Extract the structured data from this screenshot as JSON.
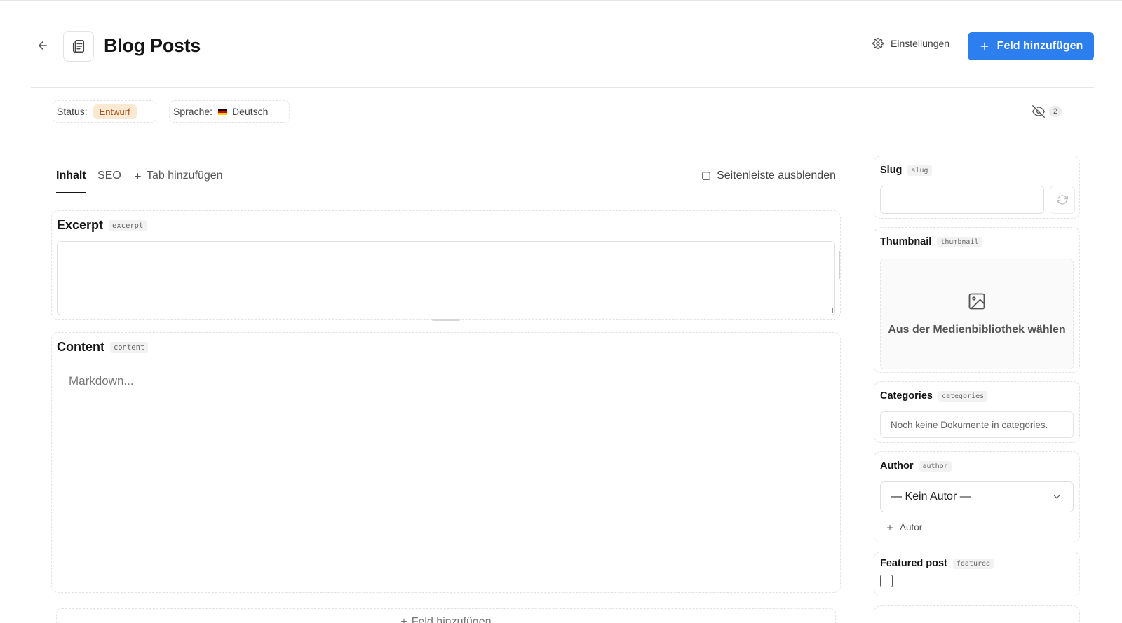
{
  "header": {
    "title": "Blog Posts",
    "settings_label": "Einstellungen",
    "add_field_label": "Feld hinzufügen"
  },
  "meta": {
    "status_label": "Status:",
    "status_value": "Entwurf",
    "language_label": "Sprache:",
    "language_value": "Deutsch",
    "hidden_fields_count": "2"
  },
  "tabs": {
    "items": [
      {
        "label": "Inhalt"
      },
      {
        "label": "SEO"
      }
    ],
    "add_tab_label": "Tab hinzufügen",
    "hide_sidebar_label": "Seitenleiste ausblenden"
  },
  "fields": {
    "excerpt": {
      "label": "Excerpt",
      "api": "excerpt",
      "value": ""
    },
    "content": {
      "label": "Content",
      "api": "content",
      "placeholder": "Markdown..."
    },
    "add_field_bottom": "Feld hinzufügen"
  },
  "sidebar": {
    "slug": {
      "label": "Slug",
      "api": "slug",
      "value": ""
    },
    "thumbnail": {
      "label": "Thumbnail",
      "api": "thumbnail",
      "media_text": "Aus der Medienbibliothek wählen"
    },
    "categories": {
      "label": "Categories",
      "api": "categories",
      "empty_text": "Noch keine Dokumente in categories."
    },
    "author": {
      "label": "Author",
      "api": "author",
      "selected": "— Kein Autor —",
      "add_label": "Autor"
    },
    "featured": {
      "label": "Featured post",
      "api": "featured",
      "checked": false
    }
  },
  "colors": {
    "primary": "#2d7ff0",
    "status_badge_bg": "#fbe9d4",
    "status_badge_text": "#b0531b"
  }
}
